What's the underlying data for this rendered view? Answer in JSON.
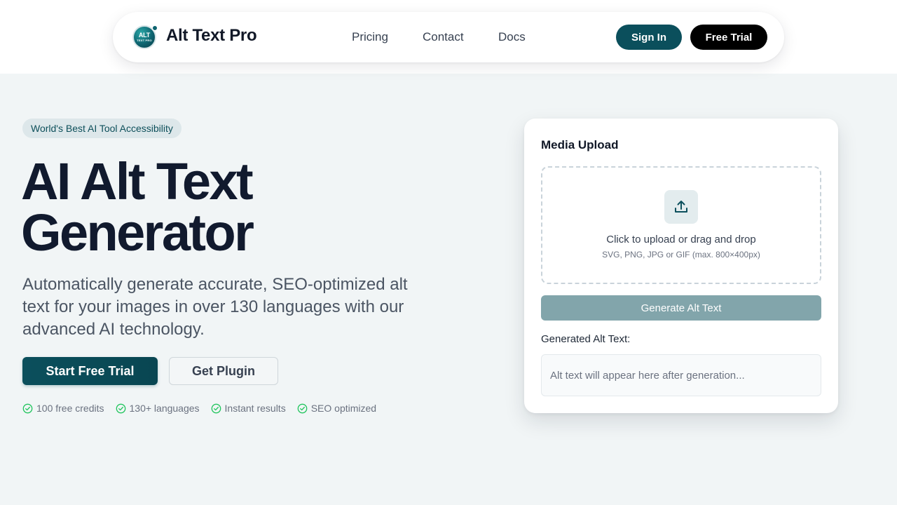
{
  "nav": {
    "brand": "Alt Text Pro",
    "logo_text_top": "ALT",
    "logo_text_bottom": "TEXT PRO",
    "links": [
      "Pricing",
      "Contact",
      "Docs"
    ],
    "sign_in": "Sign In",
    "free_trial": "Free Trial"
  },
  "hero": {
    "badge": "World's Best AI Tool Accessibility",
    "headline_line1": "AI Alt Text",
    "headline_line2": "Generator",
    "subtext": "Automatically generate accurate, SEO-optimized alt text for your images in over 130 languages with our advanced AI technology.",
    "primary_button": "Start Free Trial",
    "secondary_button": "Get Plugin",
    "features": [
      "100 free credits",
      "130+ languages",
      "Instant results",
      "SEO optimized"
    ]
  },
  "upload_card": {
    "title": "Media Upload",
    "dropzone_main": "Click to upload or drag and drop",
    "dropzone_sub": "SVG, PNG, JPG or GIF (max. 800×400px)",
    "generate_button": "Generate Alt Text",
    "output_label": "Generated Alt Text:",
    "output_placeholder": "Alt text will appear here after generation..."
  },
  "colors": {
    "accent": "#0b4f5c",
    "check_green": "#22c55e",
    "background": "#f1f5f6"
  },
  "icons": {
    "upload": "upload-icon",
    "check": "check-circle-icon",
    "logo": "alt-text-pro-logo"
  }
}
